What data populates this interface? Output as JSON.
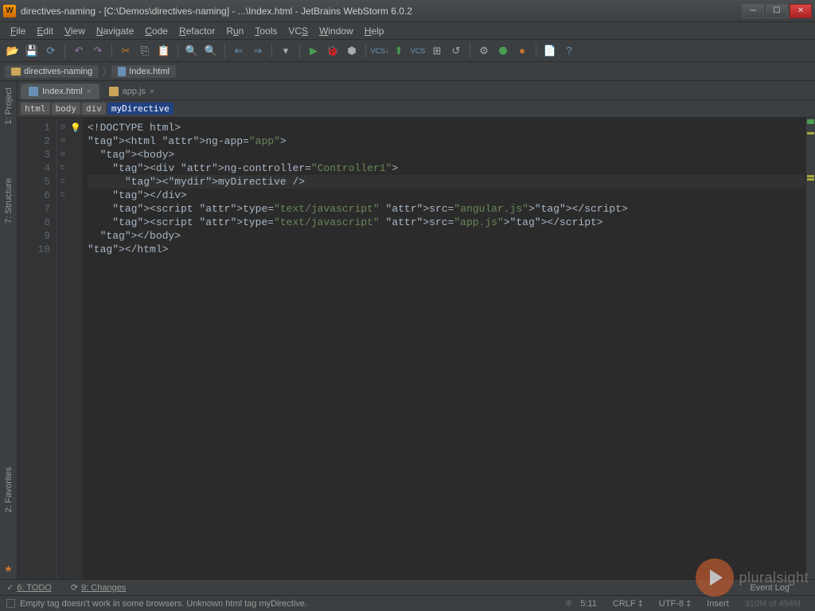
{
  "window": {
    "title": "directives-naming - [C:\\Demos\\directives-naming] - ...\\Index.html - JetBrains WebStorm 6.0.2"
  },
  "menu": [
    "File",
    "Edit",
    "View",
    "Navigate",
    "Code",
    "Refactor",
    "Run",
    "Tools",
    "VCS",
    "Window",
    "Help"
  ],
  "nav": {
    "project": "directives-naming",
    "file": "Index.html"
  },
  "tabs": [
    {
      "name": "Index.html",
      "active": true,
      "icon": "html"
    },
    {
      "name": "app.js",
      "active": false,
      "icon": "js"
    }
  ],
  "breadcrumb": [
    "html",
    "body",
    "div",
    "myDirective"
  ],
  "code_lines": [
    "<!DOCTYPE html>",
    "<html ng-app=\"app\">",
    "  <body>",
    "    <div ng-controller=\"Controller1\">",
    "      <myDirective />",
    "    </div>",
    "    <script type=\"text/javascript\" src=\"angular.js\"></script>",
    "    <script type=\"text/javascript\" src=\"app.js\"></script>",
    "  </body>",
    "</html>"
  ],
  "left_tabs": [
    "1: Project",
    "7: Structure",
    "2: Favorites"
  ],
  "bottom_tabs": {
    "todo": "6: TODO",
    "changes": "9: Changes",
    "eventlog": "Event Log"
  },
  "status": {
    "message": "Empty tag doesn't work in some browsers. Unknown html tag myDirective.",
    "pos": "5:11",
    "lineend": "CRLF",
    "enc": "UTF-8",
    "mode": "Insert",
    "mem": "310M of 494M"
  },
  "watermark": "pluralsight"
}
